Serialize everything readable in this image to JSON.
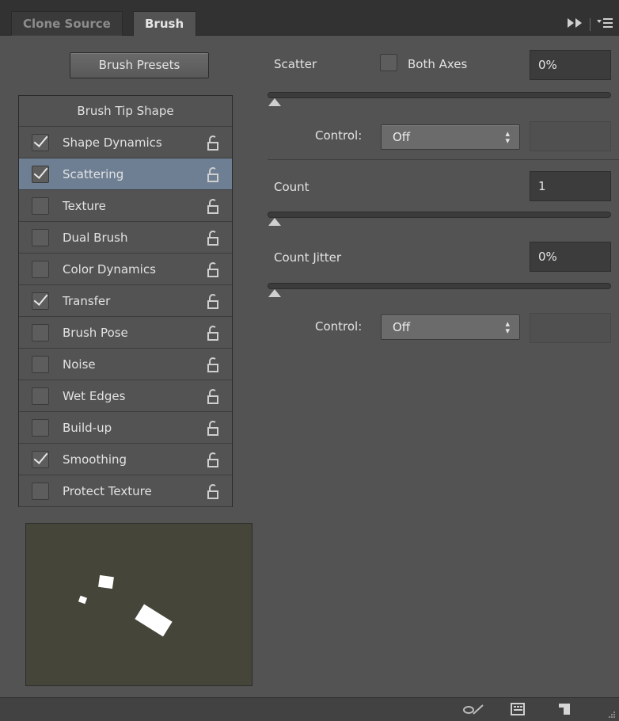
{
  "tabs": {
    "clone_source": "Clone Source",
    "brush": "Brush"
  },
  "tabbar_icons": {
    "collapse": "collapse-icon",
    "menu": "panel-menu-icon"
  },
  "presets_label": "Brush Presets",
  "list": {
    "header": "Brush Tip Shape",
    "items": [
      {
        "label": "Shape Dynamics",
        "checked": true
      },
      {
        "label": "Scattering",
        "checked": true,
        "selected": true
      },
      {
        "label": "Texture",
        "checked": false
      },
      {
        "label": "Dual Brush",
        "checked": false
      },
      {
        "label": "Color Dynamics",
        "checked": false
      },
      {
        "label": "Transfer",
        "checked": true
      },
      {
        "label": "Brush Pose",
        "checked": false
      },
      {
        "label": "Noise",
        "checked": false
      },
      {
        "label": "Wet Edges",
        "checked": false
      },
      {
        "label": "Build-up",
        "checked": false
      },
      {
        "label": "Smoothing",
        "checked": true
      },
      {
        "label": "Protect Texture",
        "checked": false
      }
    ]
  },
  "scatter": {
    "label": "Scatter",
    "both_axes_label": "Both Axes",
    "both_axes_checked": false,
    "value": "0%",
    "slider_value": 0,
    "control_label": "Control:",
    "control_value": "Off"
  },
  "count": {
    "label": "Count",
    "value": "1",
    "slider_value": 0
  },
  "count_jitter": {
    "label": "Count Jitter",
    "value": "0%",
    "slider_value": 0,
    "control_label": "Control:",
    "control_value": "Off"
  },
  "bottom_icons": [
    "toggle-live-tip-icon",
    "grid-icon",
    "new-preset-icon"
  ],
  "colors": {
    "panel": "#535353",
    "selected_row": "#6e7f94",
    "preview_bg": "#45453a"
  }
}
